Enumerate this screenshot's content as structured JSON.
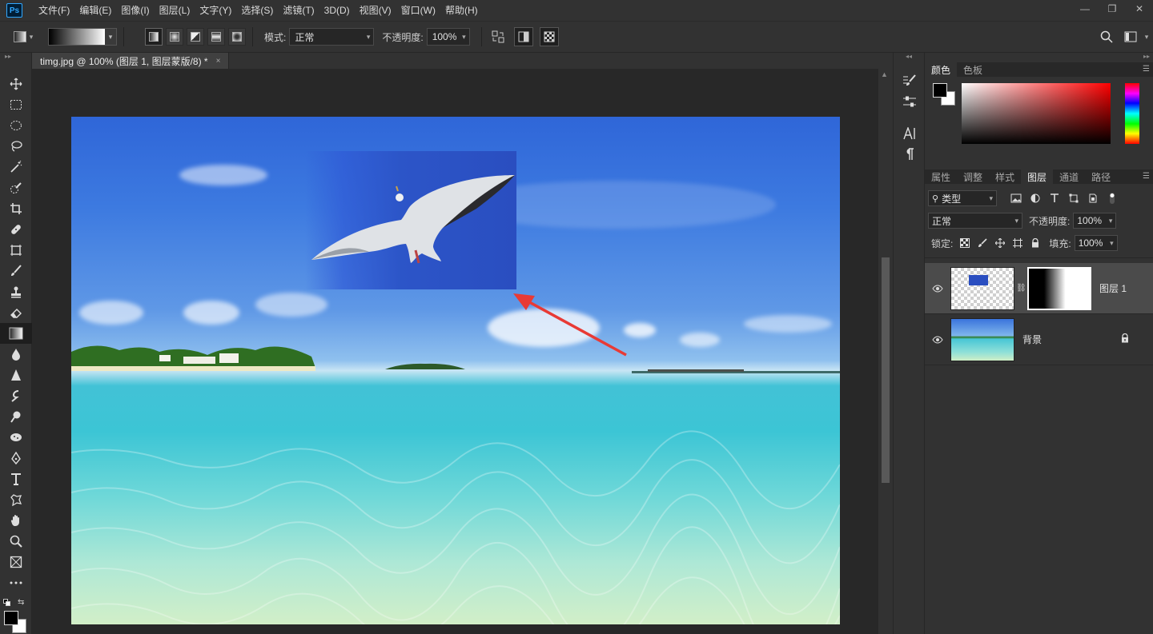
{
  "app": {
    "logo": "Ps"
  },
  "menu": [
    "文件(F)",
    "编辑(E)",
    "图像(I)",
    "图层(L)",
    "文字(Y)",
    "选择(S)",
    "滤镜(T)",
    "3D(D)",
    "视图(V)",
    "窗口(W)",
    "帮助(H)"
  ],
  "window_controls": {
    "minimize": "—",
    "restore": "❐",
    "close": "✕"
  },
  "options": {
    "mode_label": "模式:",
    "mode_value": "正常",
    "opacity_label": "不透明度:",
    "opacity_value": "100%"
  },
  "document": {
    "tab_title": "timg.jpg @ 100% (图层 1, 图层蒙版/8) *",
    "close": "×"
  },
  "color_panel": {
    "tabs": [
      "颜色",
      "色板"
    ]
  },
  "layers_panel": {
    "tabs": [
      "属性",
      "调整",
      "样式",
      "图层",
      "通道",
      "路径"
    ],
    "active_tab": "图层",
    "filter_value": "类型",
    "blend_mode": "正常",
    "opacity_label": "不透明度:",
    "opacity_value": "100%",
    "lock_label": "锁定:",
    "fill_label": "填充:",
    "fill_value": "100%",
    "layers": [
      {
        "name": "图层 1",
        "has_mask": true,
        "selected": true
      },
      {
        "name": "背景",
        "locked": true,
        "selected": false
      }
    ]
  },
  "colors": {
    "accent": "#31a8ff",
    "arrow": "#e83a35",
    "panel": "#323232",
    "canvas_bg": "#282828"
  }
}
